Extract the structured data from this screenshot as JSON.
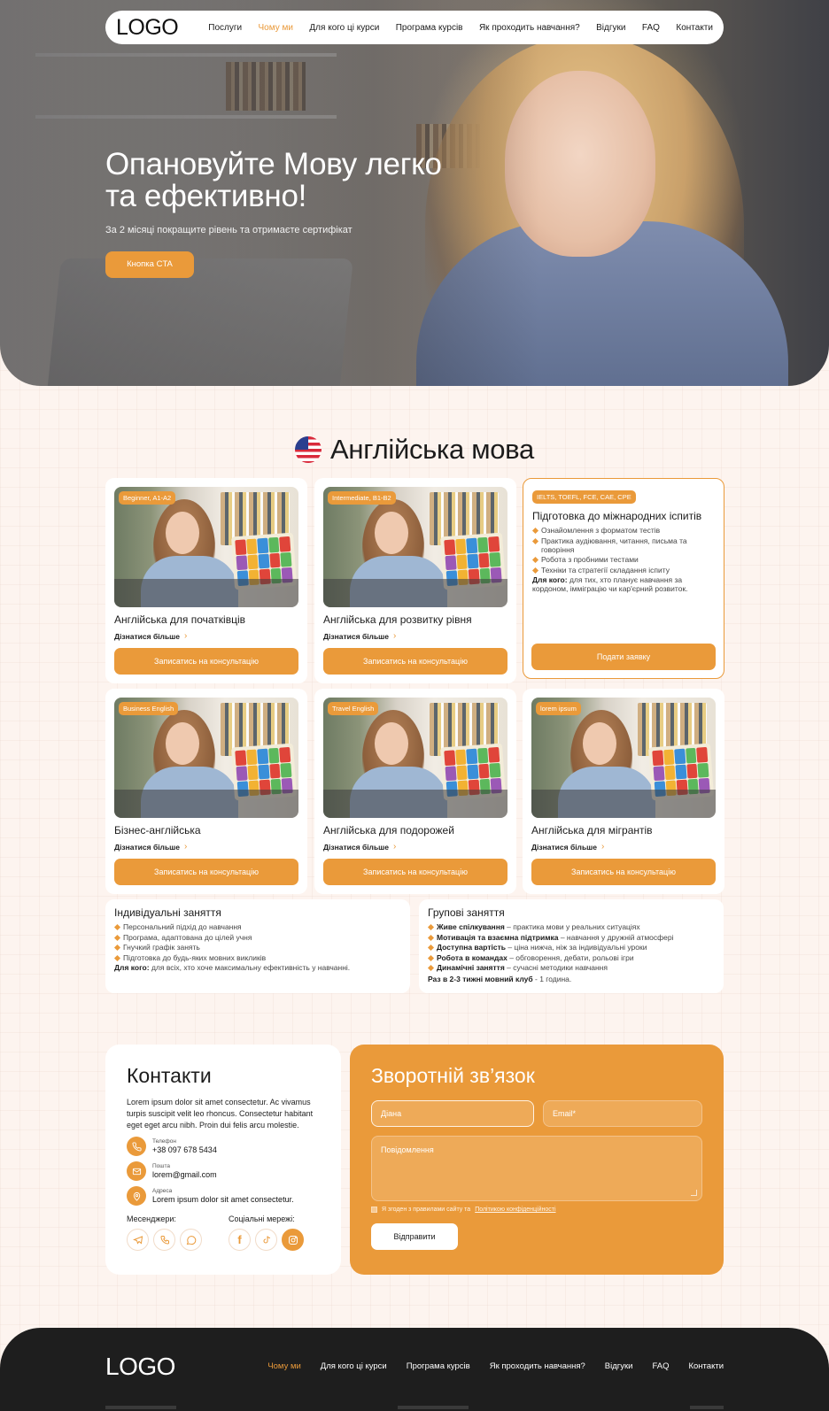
{
  "nav": {
    "logo": "LOGO",
    "links": [
      "Послуги",
      "Чому ми",
      "Для кого ці курси",
      "Програма курсів",
      "Як проходить навчання?",
      "Відгуки",
      "FAQ",
      "Контакти"
    ],
    "active_index": 1
  },
  "hero": {
    "title": "Опановуйте Мову легко та ефективно!",
    "subtitle": "За 2 місяці покращите рівень та отримаєте сертифікат",
    "cta": "Кнопка CTA"
  },
  "section": {
    "title": "Англійська мова",
    "flag_icon": "us-flag-icon"
  },
  "cards": [
    {
      "tag": "Beginner, A1-A2",
      "title": "Англійська для початківців",
      "more": "Дізнатися більше",
      "button": "Записатись на консультацію"
    },
    {
      "tag": "Intermediate, B1-B2",
      "title": "Англійська для розвитку рівня",
      "more": "Дізнатися більше",
      "button": "Записатись на консультацію"
    },
    {
      "tag": "Business English",
      "title": "Бізнес-англійська",
      "more": "Дізнатися більше",
      "button": "Записатись на консультацію"
    },
    {
      "tag": "Travel English",
      "title": "Англійська для подорожей",
      "more": "Дізнатися більше",
      "button": "Записатись на консультацію"
    },
    {
      "tag": "lorem ipsum",
      "title": "Англійська для мігрантів",
      "more": "Дізнатися більше",
      "button": "Записатись на консультацію"
    }
  ],
  "exam_card": {
    "tag": "IELTS, TOEFL, FCE, CAE, CPE",
    "title": "Підготовка до міжнародних іспитів",
    "bullets": [
      "Ознайомлення з форматом тестів",
      "Практика аудіювання, читання, письма та говоріння",
      "Робота з пробними тестами",
      "Техніки та стратегії складання іспиту"
    ],
    "for_who_label": "Для кого:",
    "for_who_text": "для тих, хто планує навчання за кордоном, імміграцію чи кар'єрний розвиток.",
    "button": "Подати заявку"
  },
  "individual": {
    "title": "Індивідуальні заняття",
    "bullets": [
      "Персональний підхід до навчання",
      "Програма, адаптована до цілей учня",
      "Гнучкий графік занять",
      "Підготовка до будь-яких мовних викликів"
    ],
    "for_who_label": "Для кого:",
    "for_who_text": "для всіх, хто хоче максимальну ефективність у навчанні."
  },
  "group": {
    "title": "Групові заняття",
    "bullets": [
      {
        "bold": "Живе спілкування",
        "text": " – практика мови у реальних ситуаціях"
      },
      {
        "bold": "Мотивація та взаємна підтримка",
        "text": " – навчання у дружній атмосфері"
      },
      {
        "bold": "Доступна вартість",
        "text": " – ціна нижча, ніж за індивідуальні уроки"
      },
      {
        "bold": "Робота в командах",
        "text": " – обговорення, дебати, рольові ігри"
      },
      {
        "bold": "Динамічні заняття",
        "text": " – сучасні методики навчання"
      }
    ],
    "note_bold": "Раз в 2-3 тижні мовний клуб",
    "note_text": " - 1 година."
  },
  "contacts": {
    "title": "Контакти",
    "description": "Lorem ipsum dolor sit amet consectetur. Ac vivamus turpis suscipit velit leo rhoncus. Consectetur habitant eget eget arcu nibh. Proin dui felis arcu molestie.",
    "items": [
      {
        "icon": "phone-icon",
        "label": "Телефон",
        "value": "+38 097 678 5434"
      },
      {
        "icon": "mail-icon",
        "label": "Пошта",
        "value": "lorem@gmail.com"
      },
      {
        "icon": "location-icon",
        "label": "Адреса",
        "value": "Lorem ipsum dolor sit amet consectetur."
      }
    ],
    "messengers_title": "Месенджери:",
    "socials_title": "Соціальні мережі:",
    "messengers": [
      "telegram-icon",
      "viber-icon",
      "whatsapp-icon"
    ],
    "socials": [
      "facebook-icon",
      "tiktok-icon",
      "instagram-icon"
    ]
  },
  "feedback": {
    "title": "Зворотній зв’язок",
    "name_placeholder": "Діана",
    "email_placeholder": "Email*",
    "message_placeholder": "Повідомлення",
    "agree_text": "Я згоден з правилами сайту та",
    "agree_link": "Політикою конфіденційності",
    "submit": "Відправити"
  },
  "footer": {
    "logo": "LOGO",
    "links": [
      "Чому ми",
      "Для кого ці курси",
      "Програма курсів",
      "Як проходить навчання?",
      "Відгуки",
      "FAQ",
      "Контакти"
    ],
    "active_index": 0
  },
  "colors": {
    "accent": "#ea9a3a",
    "background": "#fdf4ef",
    "footer": "#1e1e1e"
  }
}
